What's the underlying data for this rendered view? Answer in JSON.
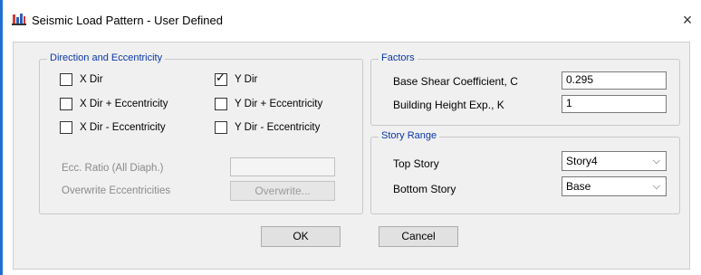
{
  "window": {
    "title": "Seismic Load Pattern - User Defined",
    "close_glyph": "×",
    "icon": "etabs-app-icon"
  },
  "direction_group": {
    "title": "Direction and Eccentricity",
    "x_dir": {
      "label": "X Dir",
      "checked": false
    },
    "x_dir_plus_ecc": {
      "label": "X Dir + Eccentricity",
      "checked": false
    },
    "x_dir_minus_ecc": {
      "label": "X Dir - Eccentricity",
      "checked": false
    },
    "y_dir": {
      "label": "Y Dir",
      "checked": true,
      "check_glyph": "✓"
    },
    "y_dir_plus_ecc": {
      "label": "Y Dir + Eccentricity",
      "checked": false
    },
    "y_dir_minus_ecc": {
      "label": "Y Dir - Eccentricity",
      "checked": false
    },
    "ecc_ratio_label": "Ecc. Ratio (All Diaph.)",
    "ecc_ratio_value": "",
    "overwrite_label": "Overwrite Eccentricities",
    "overwrite_button": "Overwrite..."
  },
  "factors_group": {
    "title": "Factors",
    "base_shear_label": "Base Shear Coefficient, C",
    "base_shear_value": "0.295",
    "height_exp_label": "Building Height Exp., K",
    "height_exp_value": "1"
  },
  "story_range_group": {
    "title": "Story Range",
    "top_story_label": "Top Story",
    "top_story_value": "Story4",
    "bottom_story_label": "Bottom Story",
    "bottom_story_value": "Base",
    "chevron_glyph": "⌵"
  },
  "buttons": {
    "ok": "OK",
    "cancel": "Cancel"
  }
}
